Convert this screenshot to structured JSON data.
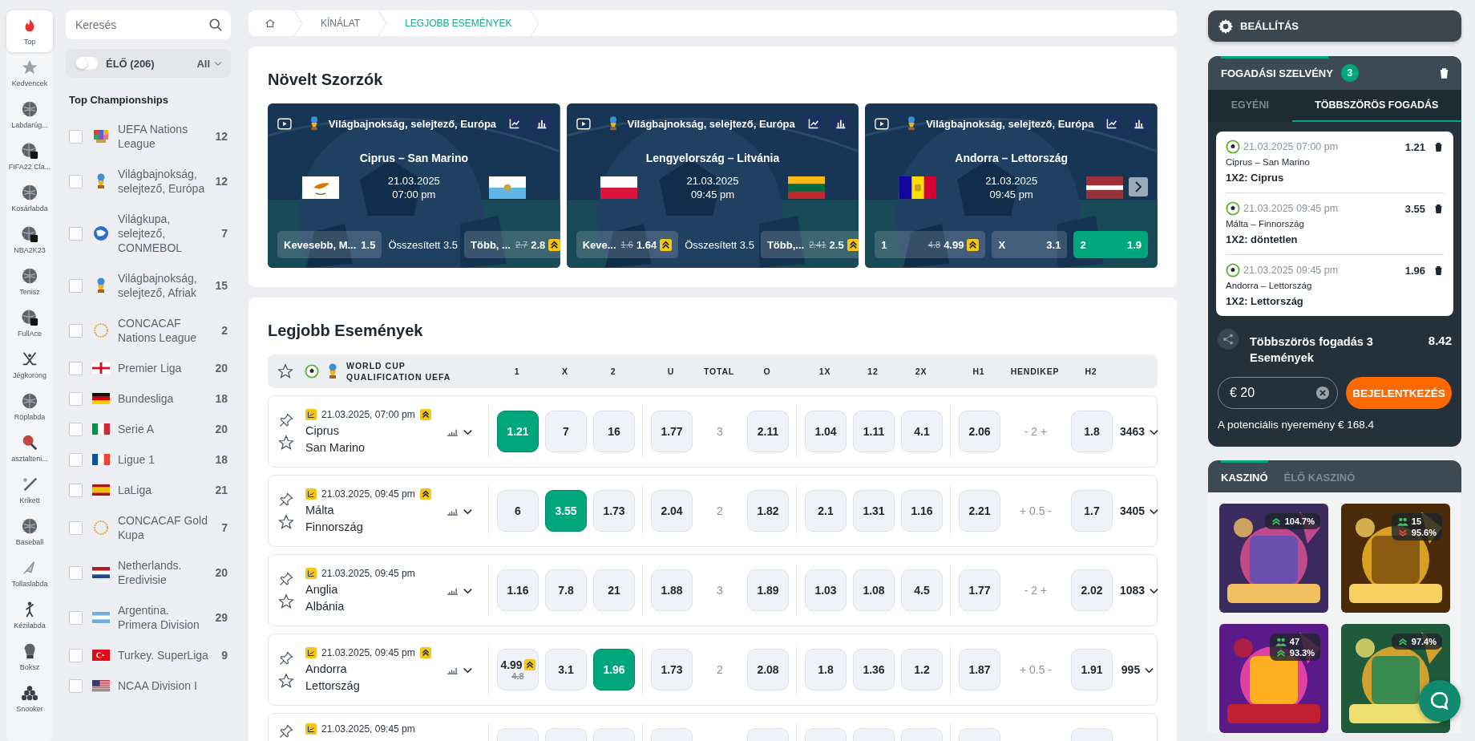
{
  "rail": [
    {
      "label": "Top",
      "selected": true
    },
    {
      "label": "Kedvencek",
      "selected": false
    },
    {
      "label": "Labdarúg...",
      "selected": false
    },
    {
      "label": "FIFA22 Cla...",
      "selected": false
    },
    {
      "label": "Kosárlabda",
      "selected": false
    },
    {
      "label": "NBA2K23",
      "selected": false
    },
    {
      "label": "Tenisz",
      "selected": false
    },
    {
      "label": "FullAce",
      "selected": false
    },
    {
      "label": "Jégkorong",
      "selected": false
    },
    {
      "label": "Röplabda",
      "selected": false
    },
    {
      "label": "asztalteni...",
      "selected": false
    },
    {
      "label": "Krikett",
      "selected": false
    },
    {
      "label": "Baseball",
      "selected": false
    },
    {
      "label": "Tollaslabda",
      "selected": false
    },
    {
      "label": "Kézilabda",
      "selected": false
    },
    {
      "label": "Boksz",
      "selected": false
    },
    {
      "label": "Snooker",
      "selected": false
    }
  ],
  "search": {
    "placeholder": "Keresés"
  },
  "live_filter": {
    "on": false,
    "label": "ÉLŐ (206)",
    "filter": "All"
  },
  "championships": {
    "title": "Top Championships",
    "items": [
      {
        "name": "UEFA Nations League",
        "count": "12",
        "checked": false
      },
      {
        "name": "Világbajnokság, selejtező, Európa",
        "count": "12",
        "checked": false
      },
      {
        "name": "Világkupa, selejtező, CONMEBOL",
        "count": "7",
        "checked": false
      },
      {
        "name": "Világbajnokság, selejtező, Afriak",
        "count": "15",
        "checked": false
      },
      {
        "name": "CONCACAF Nations League",
        "count": "2",
        "checked": false
      },
      {
        "name": "Premier Liga",
        "count": "20",
        "checked": false
      },
      {
        "name": "Bundesliga",
        "count": "18",
        "checked": false
      },
      {
        "name": "Serie A",
        "count": "20",
        "checked": false
      },
      {
        "name": "Ligue 1",
        "count": "18",
        "checked": false
      },
      {
        "name": "LaLiga",
        "count": "21",
        "checked": false
      },
      {
        "name": "CONCACAF Gold Kupa",
        "count": "7",
        "checked": false
      },
      {
        "name": "Netherlands. Eredivisie",
        "count": "20",
        "checked": false
      },
      {
        "name": "Argentina. Primera Division",
        "count": "29",
        "checked": false
      },
      {
        "name": "Turkey. SuperLiga",
        "count": "9",
        "checked": false
      },
      {
        "name": "NCAA Division I",
        "checked": false
      }
    ]
  },
  "breadcrumb": {
    "items": [
      {
        "label": "KÍNÁLAT",
        "selected": false
      },
      {
        "label": "LEGJOBB ESEMÉNYEK",
        "selected": true
      }
    ]
  },
  "boosted_odds": {
    "title": "Növelt Szorzók",
    "cards": [
      {
        "league": "Világbajnokság, selejtező, Európa",
        "match": "Ciprus – San Marino",
        "date": "21.03.2025",
        "time": "07:00 pm",
        "markets": [
          {
            "kind": "odd",
            "label": "Kevesebb, M...",
            "value": "1.5",
            "boosted": false,
            "selected": false
          },
          {
            "kind": "line",
            "label": "Összesített 3.5"
          },
          {
            "kind": "odd",
            "label": "Több, ...",
            "old": "2.7",
            "value": "2.8",
            "boosted": true,
            "selected": false
          }
        ]
      },
      {
        "league": "Világbajnokság, selejtező, Európa",
        "match": "Lengyelország – Litvánia",
        "date": "21.03.2025",
        "time": "09:45 pm",
        "markets": [
          {
            "kind": "odd",
            "label": "Keve...",
            "old": "1.6",
            "value": "1.64",
            "boosted": true,
            "selected": false
          },
          {
            "kind": "line",
            "label": "Összesített 3.5"
          },
          {
            "kind": "odd",
            "label": "Több,...",
            "old": "2.41",
            "value": "2.5",
            "boosted": true,
            "selected": false
          }
        ]
      },
      {
        "league": "Világbajnokság, selejtező, Európa",
        "match": "Andorra – Lettország",
        "date": "21.03.2025",
        "time": "09:45 pm",
        "markets": [
          {
            "kind": "odd",
            "label": "1",
            "old": "4.8",
            "value": "4.99",
            "boosted": true,
            "selected": false
          },
          {
            "kind": "odd",
            "label": "X",
            "value": "3.1",
            "boosted": false,
            "selected": false
          },
          {
            "kind": "odd",
            "label": "2",
            "value": "1.9",
            "boosted": false,
            "selected": true
          }
        ]
      }
    ]
  },
  "events": {
    "title": "Legjobb Események",
    "league": "WORLD CUP QUALIFICATION UEFA",
    "columns": [
      "1",
      "X",
      "2",
      "U",
      "TOTAL",
      "O",
      "1X",
      "12",
      "2X",
      "H1",
      "HENDIKEP",
      "H2"
    ],
    "rows": [
      {
        "date": "21.03.2025, 07:00 pm",
        "boosted": true,
        "home": "Ciprus",
        "away": "San Marino",
        "total": "3",
        "handicap": "- 2 +",
        "markets": "3463",
        "odds": [
          {
            "value": "1.21",
            "selected": true,
            "boosted": false
          },
          {
            "value": "7",
            "selected": false,
            "boosted": false
          },
          {
            "value": "16",
            "selected": false,
            "boosted": false
          },
          {
            "value": "1.77",
            "selected": false,
            "boosted": false
          },
          {
            "value": "2.11",
            "selected": false,
            "boosted": false
          },
          {
            "value": "1.04",
            "selected": false,
            "boosted": false
          },
          {
            "value": "1.11",
            "selected": false,
            "boosted": false
          },
          {
            "value": "4.1",
            "selected": false,
            "boosted": false
          },
          {
            "value": "2.06",
            "selected": false,
            "boosted": false
          },
          {
            "value": "1.8",
            "selected": false,
            "boosted": false
          }
        ]
      },
      {
        "date": "21.03.2025, 09:45 pm",
        "boosted": true,
        "home": "Málta",
        "away": "Finnország",
        "total": "2",
        "handicap": "+ 0.5 -",
        "markets": "3405",
        "odds": [
          {
            "value": "6",
            "selected": false,
            "boosted": false
          },
          {
            "value": "3.55",
            "selected": true,
            "boosted": false
          },
          {
            "value": "1.73",
            "selected": false,
            "boosted": false
          },
          {
            "value": "2.04",
            "selected": false,
            "boosted": false
          },
          {
            "value": "1.82",
            "selected": false,
            "boosted": false
          },
          {
            "value": "2.1",
            "selected": false,
            "boosted": false
          },
          {
            "value": "1.31",
            "selected": false,
            "boosted": false
          },
          {
            "value": "1.16",
            "selected": false,
            "boosted": false
          },
          {
            "value": "2.21",
            "selected": false,
            "boosted": false
          },
          {
            "value": "1.7",
            "selected": false,
            "boosted": false
          }
        ]
      },
      {
        "date": "21.03.2025, 09:45 pm",
        "boosted": false,
        "home": "Anglia",
        "away": "Albánia",
        "total": "3",
        "handicap": "- 2 +",
        "markets": "1083",
        "odds": [
          {
            "value": "1.16",
            "selected": false,
            "boosted": false
          },
          {
            "value": "7.8",
            "selected": false,
            "boosted": false
          },
          {
            "value": "21",
            "selected": false,
            "boosted": false
          },
          {
            "value": "1.88",
            "selected": false,
            "boosted": false
          },
          {
            "value": "1.89",
            "selected": false,
            "boosted": false
          },
          {
            "value": "1.03",
            "selected": false,
            "boosted": false
          },
          {
            "value": "1.08",
            "selected": false,
            "boosted": false
          },
          {
            "value": "4.5",
            "selected": false,
            "boosted": false
          },
          {
            "value": "1.77",
            "selected": false,
            "boosted": false
          },
          {
            "value": "2.02",
            "selected": false,
            "boosted": false
          }
        ]
      },
      {
        "date": "21.03.2025, 09:45 pm",
        "boosted": true,
        "home": "Andorra",
        "away": "Lettország",
        "total": "2",
        "handicap": "+ 0.5 -",
        "markets": "995",
        "odds": [
          {
            "value": "4.99",
            "old": "4.8",
            "selected": false,
            "boosted": true
          },
          {
            "value": "3.1",
            "selected": false,
            "boosted": false
          },
          {
            "value": "1.96",
            "selected": true,
            "boosted": false
          },
          {
            "value": "1.73",
            "selected": false,
            "boosted": false
          },
          {
            "value": "2.08",
            "selected": false,
            "boosted": false
          },
          {
            "value": "1.8",
            "selected": false,
            "boosted": false
          },
          {
            "value": "1.36",
            "selected": false,
            "boosted": false
          },
          {
            "value": "1.2",
            "selected": false,
            "boosted": false
          },
          {
            "value": "1.87",
            "selected": false,
            "boosted": false
          },
          {
            "value": "1.91",
            "selected": false,
            "boosted": false
          }
        ]
      },
      {
        "date": "21.03.2025, 09:45 pm",
        "boosted": false
      }
    ]
  },
  "settings": {
    "label": "BEÁLLÍTÁS"
  },
  "bet_slip": {
    "title": "FOGADÁSI SZELVÉNY",
    "count": "3",
    "tabs": [
      {
        "label": "EGYÉNI",
        "selected": false
      },
      {
        "label": "TÖBBSZÖRÖS FOGADÁS",
        "selected": true
      }
    ],
    "bets": [
      {
        "date": "21.03.2025 07:00 pm",
        "odd": "1.21",
        "match": "Ciprus – San Marino",
        "pick": "1X2: Ciprus"
      },
      {
        "date": "21.03.2025 09:45 pm",
        "odd": "3.55",
        "match": "Málta – Finnország",
        "pick": "1X2: döntetlen"
      },
      {
        "date": "21.03.2025 09:45 pm",
        "odd": "1.96",
        "match": "Andorra – Lettország",
        "pick": "1X2: Lettország"
      }
    ],
    "summary": "Többszörös fogadás 3 Események",
    "total_odds": "8.42",
    "stake": "€ 20",
    "login_button": "BEJELENTKEZÉS",
    "potential_win": "A potenciális nyeremény € 168.4"
  },
  "casino": {
    "tabs": [
      {
        "label": "KASZINÓ",
        "selected": true
      },
      {
        "label": "ÉLŐ KASZINÓ",
        "selected": false
      }
    ],
    "games": [
      {
        "rtp": "104.7%",
        "rising": true
      },
      {
        "players": "15",
        "rtp": "95.6%",
        "rising": false
      },
      {
        "players": "47",
        "rtp": "93.3%",
        "rising": true
      },
      {
        "rtp": "97.4%",
        "rising": true
      }
    ]
  }
}
